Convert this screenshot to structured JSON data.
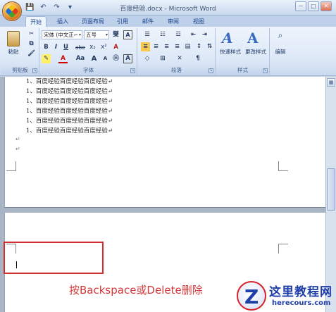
{
  "window": {
    "title": "百度经验.docx - Microsoft Word",
    "minimize": "－",
    "maximize": "□",
    "close": "✕"
  },
  "qat": [
    "💾",
    "↶",
    "↷",
    "▾"
  ],
  "tabs": [
    {
      "label": "开始",
      "active": true
    },
    {
      "label": "插入"
    },
    {
      "label": "页面布局"
    },
    {
      "label": "引用"
    },
    {
      "label": "邮件"
    },
    {
      "label": "审阅"
    },
    {
      "label": "视图"
    }
  ],
  "ribbon": {
    "clipboard": {
      "label": "剪贴板",
      "paste": "粘贴"
    },
    "font": {
      "label": "字体",
      "font_name": "宋体 (中文正⌐",
      "font_size": "五号",
      "bold": "B",
      "italic": "I",
      "underline": "U",
      "strike": "abe",
      "sub": "x₂",
      "sup": "x²",
      "case": "Aa",
      "clear": "A",
      "grow": "A",
      "shrink": "A",
      "phonetic": "燮",
      "border": "A",
      "enclose": "㊂"
    },
    "paragraph": {
      "label": "段落"
    },
    "styles": {
      "label": "样式",
      "quick": "快速样式",
      "change": "更改样式"
    },
    "editing": {
      "label": "编辑",
      "edit_label": "编辑"
    }
  },
  "document": {
    "lines": [
      "1、百度经验百度经验百度经验↵",
      "1、百度经验百度经验百度经验↵",
      "1、百度经验百度经验百度经验↵",
      "1、百度经验百度经验百度经验↵",
      "1、百度经验百度经验百度经验↵",
      "1、百度经验百度经验百度经验↵"
    ],
    "para_mark": "↵"
  },
  "instruction": "按Backspace或Delete删除",
  "watermark": {
    "title": "这里教程网",
    "sub": "herecours.com"
  }
}
